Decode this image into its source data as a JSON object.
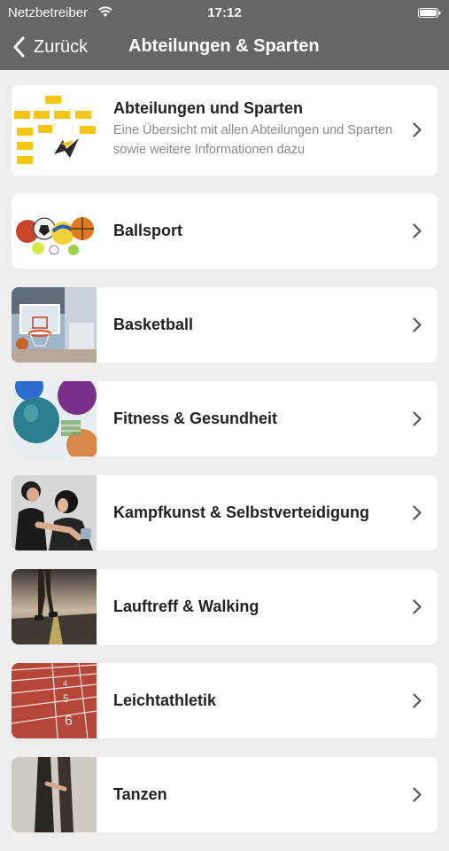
{
  "status_bar": {
    "carrier": "Netzbetreiber",
    "time": "17:12",
    "icons": [
      "wifi-icon",
      "battery-icon"
    ]
  },
  "nav": {
    "back_label": "Zurück",
    "title": "Abteilungen & Sparten"
  },
  "items": [
    {
      "title": "Abteilungen und Sparten",
      "description": "Eine Übersicht mit allen Abteilungen und Sparten sowie weitere Informationen dazu",
      "thumbnail": "org-chart-image"
    },
    {
      "title": "Ballsport",
      "thumbnail": "sports-balls-image"
    },
    {
      "title": "Basketball",
      "thumbnail": "basketball-hoop-image"
    },
    {
      "title": "Fitness & Gesundheit",
      "thumbnail": "fitness-balls-image"
    },
    {
      "title": "Kampfkunst & Selbstverteidigung",
      "thumbnail": "self-defense-image"
    },
    {
      "title": "Lauftreff & Walking",
      "thumbnail": "runner-image"
    },
    {
      "title": "Leichtathletik",
      "thumbnail": "running-track-image"
    },
    {
      "title": "Tanzen",
      "thumbnail": "dance-image"
    }
  ],
  "colors": {
    "header": "#666666",
    "background": "#eeeeee",
    "card": "#ffffff",
    "title_text": "#222222",
    "secondary_text": "#8a8a8a",
    "chevron": "#555555"
  }
}
